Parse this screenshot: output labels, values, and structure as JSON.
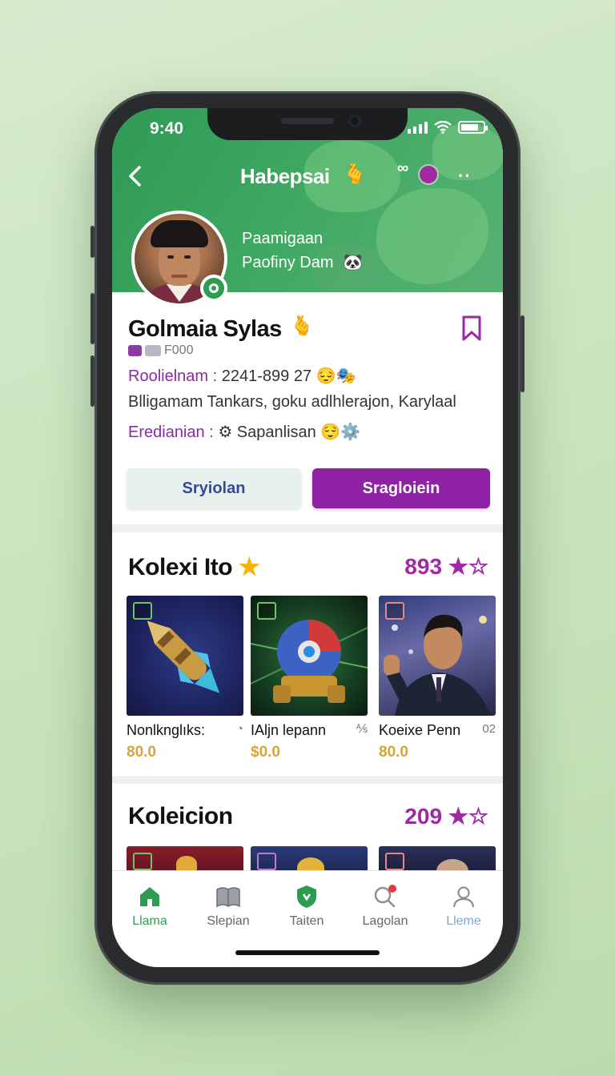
{
  "status": {
    "time": "9:40"
  },
  "header": {
    "title": "Habepsai",
    "title_emoji": "🫰",
    "icon_oo": "∞",
    "more": "··",
    "subtitle_line1": "Paamigaan",
    "subtitle_line2": "Paofiny Dam",
    "subtitle_icon": "🐼"
  },
  "profile": {
    "name": "Golmaia Sylas",
    "name_emoji": "🫰",
    "tag_text": "F000",
    "row1_key": "Roolielnam :",
    "row1_value": "2241-899 27",
    "row1_icons": "😔🎭",
    "row2": "Blligamam Tankars, goku adlhlerajon, Karylaal",
    "row3_key": "Eredianian :",
    "row3_value": "⚙ Sapanlisan",
    "row3_icons": "😌⚙️"
  },
  "actions": {
    "secondary": "Sryiolan",
    "primary": "Sragloiein"
  },
  "section1": {
    "title": "Kolexi Ito",
    "title_star": "★",
    "count": "893",
    "count_stars": "★☆",
    "cards": [
      {
        "name": "Nonlknglıks:",
        "extra": "◔",
        "price": "80.0"
      },
      {
        "name": "IAljn lepann",
        "extra": "⅍",
        "price": "$0.0"
      },
      {
        "name": "Koeixe Penn",
        "extra": "02",
        "price": "80.0"
      }
    ]
  },
  "section2": {
    "title": "Koleicion",
    "count": "209",
    "count_stars": "★☆"
  },
  "nav": {
    "items": [
      {
        "label": "Llama",
        "icon": "home-icon"
      },
      {
        "label": "Slepian",
        "icon": "book-icon"
      },
      {
        "label": "Taiten",
        "icon": "shield-icon"
      },
      {
        "label": "Lagolan",
        "icon": "search-icon"
      },
      {
        "label": "Lleme",
        "icon": "user-icon"
      }
    ]
  },
  "colors": {
    "primary": "#8f21a4",
    "header_green": "#3ea862",
    "accent_gold": "#d2a63a"
  }
}
